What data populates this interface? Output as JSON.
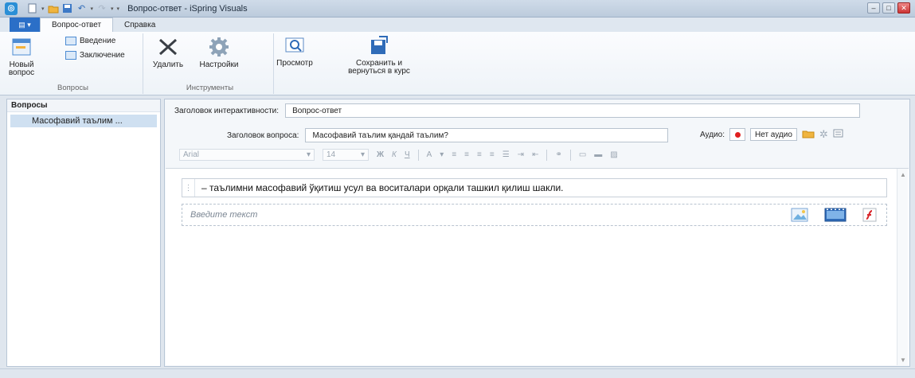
{
  "window": {
    "title": "Вопрос-ответ - iSpring Visuals"
  },
  "tabs": [
    {
      "label": "Вопрос-ответ"
    },
    {
      "label": "Справка"
    }
  ],
  "ribbon": {
    "new_question": "Новый вопрос",
    "intro": "Введение",
    "conclusion": "Заключение",
    "group_questions": "Вопросы",
    "delete": "Удалить",
    "settings": "Настройки",
    "preview": "Просмотр",
    "save_return": "Сохранить и вернуться в курс",
    "group_tools": "Инструменты"
  },
  "left_panel": {
    "header": "Вопросы",
    "items": [
      {
        "label": "Масофавий таълим ..."
      }
    ]
  },
  "form": {
    "interactivity_title_label": "Заголовок интерактивности:",
    "interactivity_title_value": "Вопрос-ответ",
    "question_title_label": "Заголовок вопроса:",
    "question_title_value": "Масофавий таълим  қандай таълим?",
    "audio_label": "Аудио:",
    "audio_button": "Нет аудио"
  },
  "toolbar": {
    "font": "Arial",
    "size": "14",
    "bold": "Ж",
    "italic": "К",
    "underline": "Ч",
    "font_color": "A"
  },
  "editor": {
    "answer_text": "– таълимни масофавий ўқитиш усул ва воситалари орқали ташкил қилиш шакли.",
    "placeholder": "Введите текст"
  },
  "colors": {
    "accent": "#2b6fc7",
    "selection": "#cfe0f1",
    "record": "#e02020"
  }
}
